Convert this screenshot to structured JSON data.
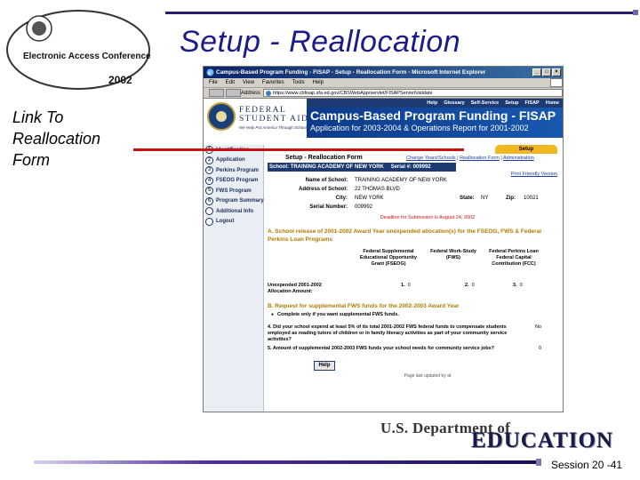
{
  "slide": {
    "title": "Setup  - Reallocation",
    "callout": [
      "Link To",
      "Reallocation",
      "Form"
    ],
    "session": "Session 20 -41",
    "logo_text": "Electronic Access Conference",
    "logo_year": "2002",
    "footer_brand_line1": "U.S. Department of",
    "footer_brand_line2": "EDUCATION"
  },
  "browser": {
    "window_title": "Campus-Based Program Funding - FISAP - Setup - Reallocation Form - Microsoft Internet Explorer",
    "menu": [
      "File",
      "Edit",
      "View",
      "Favorites",
      "Tools",
      "Help"
    ],
    "address_label": "Address",
    "address_url": "https://www.cbfisap.sfa.ed.gov/CBSWebApp/servlet/FISAPServletValidate"
  },
  "fsa": {
    "brand_line1": "FEDERAL",
    "brand_line2": "STUDENT AID",
    "tagline": "We Help Put America Through School",
    "top_nav": [
      "Help",
      "Glossary",
      "Self-Service",
      "Setup",
      "FISAP",
      "Home"
    ],
    "banner_title": "Campus-Based Program Funding - FISAP",
    "banner_subtitle": "Application for 2003-2004 & Operations Report for 2001-2002",
    "sidebar": [
      {
        "num": "1",
        "label": "Identification"
      },
      {
        "num": "2",
        "label": "Application"
      },
      {
        "num": "3",
        "label": "Perkins Program"
      },
      {
        "num": "4",
        "label": "FSEOG Program"
      },
      {
        "num": "5",
        "label": "FWS Program"
      },
      {
        "num": "6",
        "label": "Program Summary"
      },
      {
        "num": "",
        "label": "Additional Info"
      },
      {
        "num": "",
        "label": "Logout"
      }
    ],
    "tab_setup": "Setup",
    "form_title": "Setup - Reallocation Form",
    "form_links": [
      "Change Years/Schools",
      "Reallocation Form",
      "Administration"
    ],
    "school_bar": "School: TRAINING ACADEMY OF NEW YORK",
    "serial_bar": "Serial #: 009992",
    "print_link": "Print Friendly Version",
    "info": {
      "name_label": "Name of School:",
      "name_value": "TRAINING ACADEMY OF NEW YORK",
      "address_label": "Address of School:",
      "address_value": "22 THOMAS BLVD",
      "city_label": "City:",
      "city_value": "NEW YORK",
      "state_label": "State:",
      "state_value": "NY",
      "zip_label": "Zip:",
      "zip_value": "10021",
      "serial_label": "Serial Number:",
      "serial_value": "009992"
    },
    "deadline": "Deadline for Submission is August 24, 2002",
    "section_a": "A. School release of 2001-2002 Award Year unexpended allocation(s) for the FSEOG, FWS & Federal Perkins Loan Programs",
    "col_fseog": "Federal Supplemental Educational Opportunity Grant (FSEOG)",
    "col_fws": "Federal Work-Study (FWS)",
    "col_perkins": "Federal Perkins Loan Federal Capital Contribution (FCC)",
    "unexpended_label": "Unexpended 2001-2002 Allocation Amount:",
    "alloc_values": [
      {
        "idx": "1.",
        "val": "0"
      },
      {
        "idx": "2.",
        "val": "0"
      },
      {
        "idx": "3.",
        "val": "0"
      }
    ],
    "section_b": "B. Request for supplemental FWS funds for the 2002-2003 Award Year",
    "bullet": "Complete only if you want supplemental FWS funds.",
    "q4_text": "4. Did your school expend at least 5% of its total 2001-2002 FWS federal funds to compensate students employed as reading tutors of children or in family literacy activities as part of your community service activities?",
    "q4_ans": "No",
    "q5_text": "5. Amount of supplemental 2002-2003 FWS funds your school needs for community service jobs?",
    "q5_ans": "0",
    "help_button": "Help",
    "updated": "Page last updated by at"
  }
}
